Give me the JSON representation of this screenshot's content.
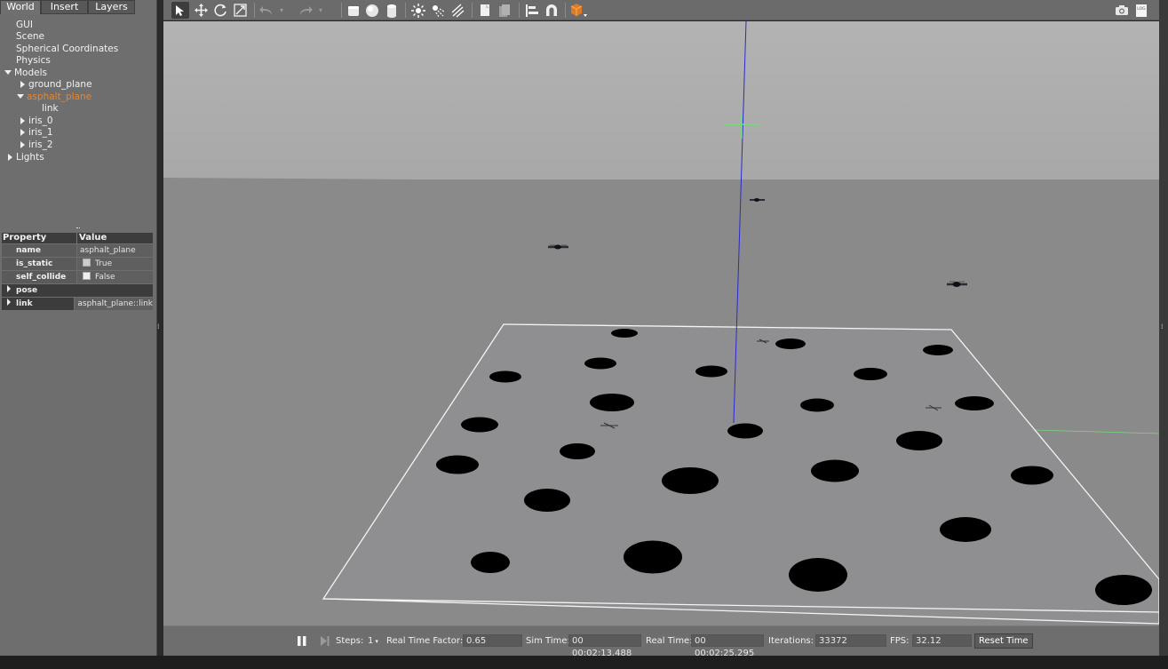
{
  "left_panel": {
    "tabs": [
      "World",
      "Insert",
      "Layers"
    ],
    "tree": {
      "gui": "GUI",
      "scene": "Scene",
      "spherical": "Spherical Coordinates",
      "physics": "Physics",
      "models": "Models",
      "ground_plane": "ground_plane",
      "asphalt_plane": "asphalt_plane",
      "link": "link",
      "iris_0": "iris_0",
      "iris_1": "iris_1",
      "iris_2": "iris_2",
      "lights": "Lights"
    },
    "properties": {
      "header": {
        "property": "Property",
        "value": "Value"
      },
      "rows": [
        {
          "key": "name",
          "value": "asphalt_plane"
        },
        {
          "key": "is_static",
          "value": "True"
        },
        {
          "key": "self_collide",
          "value": "False"
        },
        {
          "key": "pose",
          "value": ""
        },
        {
          "key": "link",
          "value": "asphalt_plane::link"
        }
      ]
    }
  },
  "toolbar": {
    "tools": [
      "select-tool",
      "translate-tool",
      "rotate-tool",
      "scale-tool",
      "undo",
      "redo",
      "box-shape",
      "sphere-shape",
      "cylinder-shape",
      "point-light",
      "spot-light",
      "directional-light",
      "copy",
      "paste",
      "align",
      "snap",
      "change-view"
    ]
  },
  "status_bar": {
    "steps_label": "Steps:",
    "steps_value": "1",
    "rtf_label": "Real Time Factor:",
    "rtf_value": "0.65",
    "sim_time_label": "Sim Time:",
    "sim_time_value": "00 00:02:13.488",
    "real_time_label": "Real Time:",
    "real_time_value": "00 00:02:25.295",
    "iterations_label": "Iterations:",
    "iterations_value": "33372",
    "fps_label": "FPS:",
    "fps_value": "32.12",
    "reset_label": "Reset Time"
  },
  "colors": {
    "panel_bg": "#6e6e6e",
    "selected_model": "#e8862c",
    "sky": "#b0b0b0",
    "ground": "#8a8a8a",
    "asphalt": "#8e8e8e",
    "z_axis": "#2a2ad0",
    "landing_marker": "#6ee06e"
  }
}
